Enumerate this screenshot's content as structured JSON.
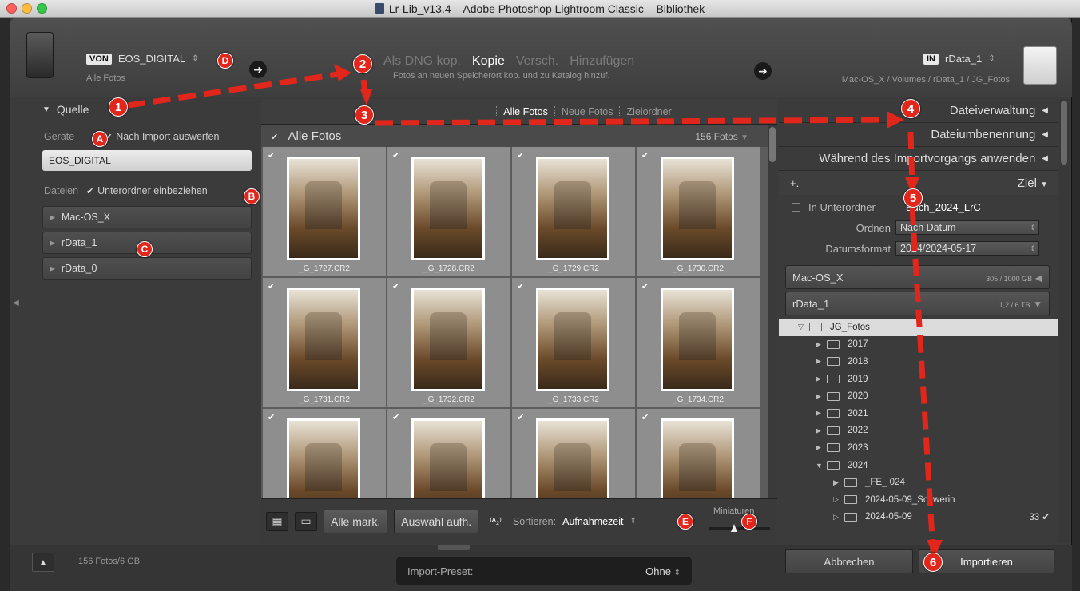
{
  "window": {
    "title": "Lr-Lib_v13.4 – Adobe Photoshop Lightroom Classic – Bibliothek"
  },
  "source": {
    "tag": "VON",
    "device": "EOS_DIGITAL",
    "subtitle": "Alle Fotos"
  },
  "modes": {
    "items": [
      "Als DNG kop.",
      "Kopie",
      "Versch.",
      "Hinzufügen"
    ],
    "active": "Kopie",
    "description": "Fotos an neuen Speicherort kop. und zu Katalog hinzuf."
  },
  "destination": {
    "tag": "IN",
    "volume": "rData_1",
    "path": "Mac-OS_X / Volumes / rData_1 / JG_Fotos"
  },
  "left_panel": {
    "title": "Quelle",
    "geraete_label": "Geräte",
    "eject_label": "Nach Import auswerfen",
    "device_item": "EOS_DIGITAL",
    "dateien_label": "Dateien",
    "subfolders_label": "Unterordner einbeziehen",
    "volumes": [
      "Mac-OS_X",
      "rData_1",
      "rData_0"
    ]
  },
  "center": {
    "tabs": [
      "Alle Fotos",
      "Neue Fotos",
      "Zielordner"
    ],
    "active_tab": "Alle Fotos",
    "grid_title": "Alle Fotos",
    "grid_count": "156 Fotos",
    "files": [
      "_G_1727.CR2",
      "_G_1728.CR2",
      "_G_1729.CR2",
      "_G_1730.CR2",
      "_G_1731.CR2",
      "_G_1732.CR2",
      "_G_1733.CR2",
      "_G_1734.CR2",
      "",
      "",
      "",
      ""
    ]
  },
  "toolbar": {
    "mark_all": "Alle mark.",
    "unmark": "Auswahl aufh.",
    "sort_icon": "⁽ᴬ₂⁾",
    "sort_label": "Sortieren:",
    "sort_value": "Aufnahmezeit",
    "thumbs_label": "Miniaturen"
  },
  "right_panel": {
    "sections": [
      "Dateiverwaltung",
      "Dateiumbenennung",
      "Während des Importvorgangs anwenden"
    ],
    "ziel_label": "Ziel",
    "plus": "+.",
    "in_subfolder_label": "In Unterordner",
    "subfolder_name": "Buch_2024_LrC",
    "ordnen_label": "Ordnen",
    "ordnen_value": "Nach Datum",
    "datumsformat_label": "Datumsformat",
    "datumsformat_value": "2024/2024-05-17",
    "volumes": [
      {
        "name": "Mac-OS_X",
        "size": "305 / 1000 GB",
        "tri": "◀"
      },
      {
        "name": "rData_1",
        "size": "1,2 / 6 TB",
        "tri": "▼"
      }
    ],
    "tree": [
      {
        "name": "JG_Fotos",
        "indent": 0,
        "tw": "▽",
        "sel": true
      },
      {
        "name": "2017",
        "indent": 1,
        "tw": "▶"
      },
      {
        "name": "2018",
        "indent": 1,
        "tw": "▶"
      },
      {
        "name": "2019",
        "indent": 1,
        "tw": "▶"
      },
      {
        "name": "2020",
        "indent": 1,
        "tw": "▶"
      },
      {
        "name": "2021",
        "indent": 1,
        "tw": "▶"
      },
      {
        "name": "2022",
        "indent": 1,
        "tw": "▶"
      },
      {
        "name": "2023",
        "indent": 1,
        "tw": "▶"
      },
      {
        "name": "2024",
        "indent": 1,
        "tw": "▼"
      },
      {
        "name": "_FE_ 024",
        "indent": 2,
        "tw": "▶"
      },
      {
        "name": "2024-05-09_Schwerin",
        "indent": 2,
        "tw": "▷"
      },
      {
        "name": "2024-05-09",
        "indent": 2,
        "tw": "▷",
        "count": "33 ✔"
      }
    ]
  },
  "footer": {
    "info": "156 Fotos/6 GB",
    "preset_label": "Import-Preset:",
    "preset_value": "Ohne",
    "cancel": "Abbrechen",
    "import": "Importieren"
  },
  "callouts": {
    "numbers": [
      "1",
      "2",
      "3",
      "4",
      "5",
      "6"
    ],
    "letters": [
      "A",
      "B",
      "C",
      "D",
      "E",
      "F"
    ],
    "color": "#e1261c"
  }
}
